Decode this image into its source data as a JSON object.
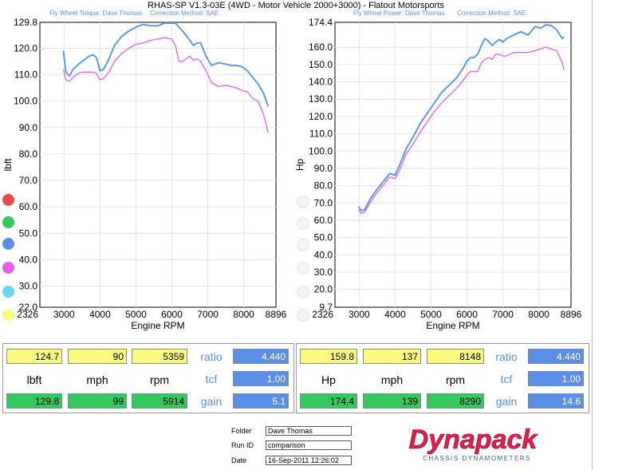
{
  "header": {
    "title": "RHAS-SP V1.3-03E  (4WD - Motor Vehicle 2000+3000) - Flatout Motorsports",
    "torque_operator": "Fly Wheel Torque: Dave Thomas",
    "torque_correction": "Correction Method: SAE",
    "power_operator": "Fly Wheel Power: Dave Thomas",
    "power_correction": "Correction Method: SAE"
  },
  "colors": {
    "blue_run": "#5a9be8",
    "magenta_run": "#e85ce8",
    "yellow_cell": "#fbfb80",
    "green_cell": "#34c85e",
    "blue_cell": "#5a8fe6"
  },
  "legend_dots": [
    "#f04848",
    "#34c85e",
    "#5a8fe6",
    "#e85ce8",
    "#62d8f0",
    "#fbfb80"
  ],
  "chart_data": [
    {
      "type": "line",
      "ylabel": "lbft",
      "xlabel": "Engine RPM",
      "xlim": [
        2326,
        8896
      ],
      "ylim": [
        22.0,
        129.8
      ],
      "x_ticks": [
        "2326",
        "3000",
        "4000",
        "5000",
        "6000",
        "7000",
        "8000",
        "8896"
      ],
      "y_ticks": [
        "129.8",
        "120.0",
        "110.0",
        "100.0",
        "90.0",
        "80.0",
        "70.0",
        "60.0",
        "50.0",
        "40.0",
        "30.0",
        "22.0"
      ],
      "series": [
        {
          "color": "#5a9be8",
          "x": [
            2980,
            3050,
            3150,
            3250,
            3400,
            3550,
            3700,
            3800,
            3900,
            4000,
            4100,
            4250,
            4400,
            4600,
            4800,
            5000,
            5200,
            5400,
            5600,
            5800,
            6000,
            6100,
            6200,
            6300,
            6500,
            6600,
            6700,
            6800,
            6950,
            7100,
            7300,
            7500,
            7650,
            7800,
            7950,
            8100,
            8250,
            8400,
            8550,
            8680
          ],
          "y": [
            119,
            111,
            109.5,
            112,
            114,
            115.5,
            117,
            117.5,
            116.5,
            111.5,
            112,
            116,
            121,
            124.5,
            126.5,
            128,
            129,
            128.5,
            128.5,
            129.5,
            129.5,
            129.5,
            128,
            126.5,
            123,
            121,
            122,
            122,
            117,
            113.5,
            114.5,
            114,
            113.5,
            113.5,
            113,
            111.5,
            109,
            106.5,
            103,
            98
          ]
        },
        {
          "color": "#e85ce8",
          "x": [
            2980,
            3050,
            3150,
            3250,
            3400,
            3550,
            3700,
            3800,
            3900,
            4000,
            4100,
            4250,
            4400,
            4600,
            4800,
            5000,
            5200,
            5400,
            5600,
            5800,
            6000,
            6100,
            6200,
            6300,
            6500,
            6600,
            6700,
            6800,
            6950,
            7100,
            7300,
            7500,
            7650,
            7800,
            7950,
            8100,
            8250,
            8400,
            8550,
            8680
          ],
          "y": [
            112,
            108,
            107.5,
            109,
            110.5,
            111,
            111,
            111,
            110.5,
            108,
            108.5,
            111,
            115,
            118,
            120,
            121.5,
            122,
            123,
            123.5,
            124,
            123.5,
            121,
            115,
            115,
            117,
            115.5,
            116,
            115,
            111.5,
            107,
            105.5,
            106,
            105.5,
            105,
            104,
            103.5,
            101,
            100,
            95,
            88
          ]
        }
      ]
    },
    {
      "type": "line",
      "ylabel": "Hp",
      "xlabel": "Engine RPM",
      "xlim": [
        2326,
        8896
      ],
      "ylim": [
        9.7,
        174.4
      ],
      "x_ticks": [
        "2326",
        "3000",
        "4000",
        "5000",
        "6000",
        "7000",
        "8000",
        "8896"
      ],
      "y_ticks": [
        "174.4",
        "160.0",
        "150.0",
        "140.0",
        "130.0",
        "120.0",
        "110.0",
        "100.0",
        "90.0",
        "80.0",
        "70.0",
        "60.0",
        "50.0",
        "40.0",
        "30.0",
        "20.0",
        "9.7"
      ],
      "series": [
        {
          "color": "#5a9be8",
          "x": [
            2980,
            3050,
            3150,
            3300,
            3500,
            3700,
            3850,
            4000,
            4150,
            4300,
            4500,
            4700,
            4900,
            5100,
            5300,
            5500,
            5700,
            5900,
            6000,
            6100,
            6200,
            6300,
            6400,
            6500,
            6600,
            6700,
            6800,
            6900,
            7000,
            7100,
            7300,
            7500,
            7700,
            7900,
            8050,
            8200,
            8350,
            8500,
            8650,
            8700
          ],
          "y": [
            68,
            65.5,
            66,
            72,
            78,
            83,
            87,
            86,
            93,
            101,
            108,
            116,
            122,
            128,
            134,
            138,
            142,
            148,
            152,
            154,
            154,
            156,
            161,
            165,
            163.5,
            161,
            163,
            164.5,
            163,
            165,
            167,
            169,
            167,
            172,
            171,
            173,
            172.5,
            170,
            165,
            166
          ]
        },
        {
          "color": "#e85ce8",
          "x": [
            2980,
            3050,
            3150,
            3300,
            3500,
            3700,
            3850,
            4000,
            4150,
            4300,
            4500,
            4700,
            4900,
            5100,
            5300,
            5500,
            5700,
            5900,
            6000,
            6100,
            6200,
            6300,
            6400,
            6500,
            6600,
            6700,
            6800,
            6900,
            7000,
            7100,
            7300,
            7500,
            7700,
            7900,
            8050,
            8200,
            8350,
            8500,
            8650,
            8700
          ],
          "y": [
            66,
            64,
            64.5,
            70,
            76,
            81,
            85,
            84,
            90,
            98,
            104,
            111,
            117,
            123,
            128,
            132,
            136,
            141,
            144,
            146,
            146,
            146,
            151,
            153,
            154,
            153,
            156,
            156,
            155,
            155,
            157,
            157,
            157,
            158,
            159,
            160,
            159,
            158,
            151,
            147
          ]
        }
      ]
    }
  ],
  "left_panel": {
    "row1": [
      "124.7",
      "90",
      "5359"
    ],
    "units": [
      "lbft",
      "mph",
      "rpm"
    ],
    "row3": [
      "129.8",
      "99",
      "5914"
    ],
    "side_labels": [
      "ratio",
      "tcf",
      "gain"
    ],
    "side_values": [
      "4.440",
      "1.00",
      "5.1"
    ]
  },
  "right_panel": {
    "row1": [
      "159.8",
      "137",
      "8148"
    ],
    "units": [
      "Hp",
      "mph",
      "rpm"
    ],
    "row3": [
      "174.4",
      "139",
      "8290"
    ],
    "side_labels": [
      "ratio",
      "tcf",
      "gain"
    ],
    "side_values": [
      "4.440",
      "1.00",
      "14.6"
    ]
  },
  "footer": {
    "folder_label": "Folder",
    "folder_value": "Dave Thomas",
    "run_label": "Run ID",
    "run_value": "comparison",
    "date_label": "Date",
    "date_value": "16-Sep-2011  12:26:02"
  },
  "logo": {
    "brand": "Dynapack",
    "tagline": "CHASSIS    DYNAMOMETERS"
  }
}
